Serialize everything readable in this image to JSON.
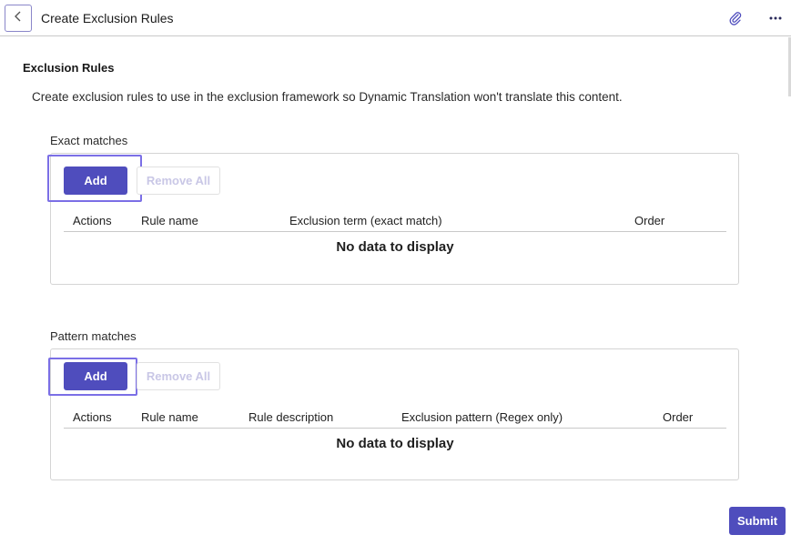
{
  "header": {
    "title": "Create Exclusion Rules",
    "back_icon": "chevron-left-icon",
    "attach_icon": "paperclip-icon",
    "more_icon": "more-horizontal-icon"
  },
  "main": {
    "heading": "Exclusion Rules",
    "description": "Create exclusion rules to use in the exclusion framework so Dynamic Translation won't translate this content."
  },
  "exact": {
    "label": "Exact matches",
    "add_label": "Add",
    "remove_all_label": "Remove All",
    "columns": [
      "Actions",
      "Rule name",
      "Exclusion term (exact match)",
      "Order"
    ],
    "empty_text": "No data to display"
  },
  "pattern": {
    "label": "Pattern matches",
    "add_label": "Add",
    "remove_all_label": "Remove All",
    "columns": [
      "Actions",
      "Rule name",
      "Rule description",
      "Exclusion pattern (Regex only)",
      "Order"
    ],
    "empty_text": "No data to display"
  },
  "footer": {
    "submit_label": "Submit"
  },
  "colors": {
    "accent": "#4f4dbd",
    "focus": "#7b6fe6",
    "disabled_text": "#c9c7e6",
    "border": "#d4d4d4"
  }
}
